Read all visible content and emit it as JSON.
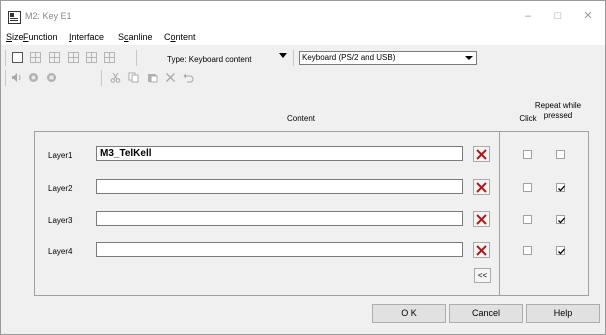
{
  "window": {
    "title": "M2: Key E1",
    "controls": [
      "–",
      "□",
      "✕"
    ]
  },
  "menu": [
    {
      "label": "Size",
      "mnemonic": "S"
    },
    {
      "label": "Function",
      "mnemonic": "F"
    },
    {
      "label": "Interface",
      "mnemonic": "I"
    },
    {
      "label": "Scanline",
      "mnemonic": "c"
    },
    {
      "label": "Content",
      "mnemonic": "o"
    }
  ],
  "toolbar": {
    "type_label": "Type: Keyboard content",
    "interface_value": "Keyboard (PS/2 and USB)"
  },
  "content": {
    "header_content": "Content",
    "header_click": "Click",
    "header_repeat_line1": "Repeat while",
    "header_repeat_line2": "pressed",
    "layers": [
      {
        "label": "Layer1",
        "value": "M3_TelKell",
        "click": false,
        "repeat": false
      },
      {
        "label": "Layer2",
        "value": "",
        "click": false,
        "repeat": true
      },
      {
        "label": "Layer3",
        "value": "",
        "click": false,
        "repeat": true
      },
      {
        "label": "Layer4",
        "value": "",
        "click": false,
        "repeat": true
      }
    ],
    "collapse_label": "<<"
  },
  "buttons": {
    "ok": "O K",
    "cancel": "Cancel",
    "help": "Help"
  }
}
